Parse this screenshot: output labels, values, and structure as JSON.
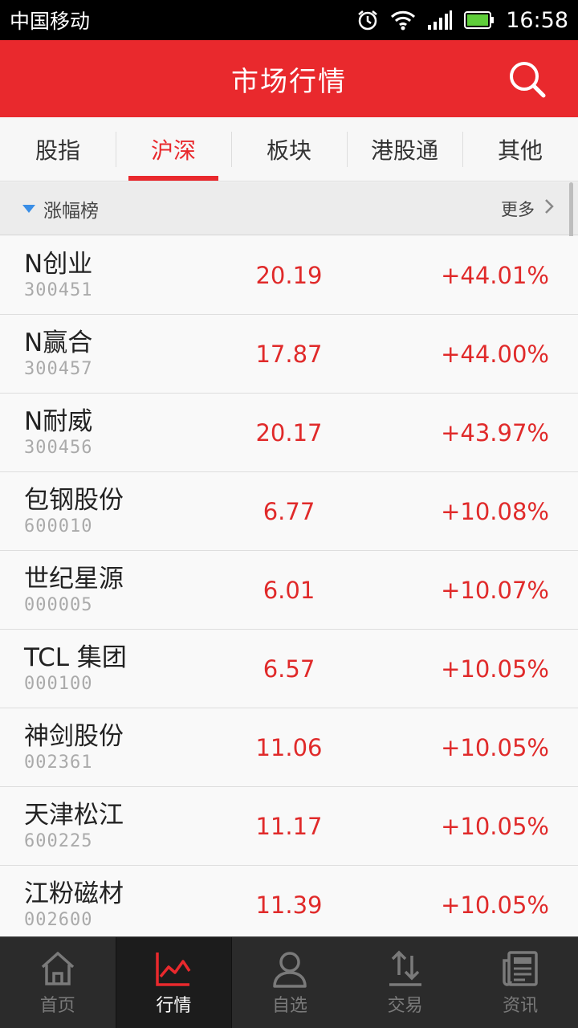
{
  "status_bar": {
    "carrier": "中国移动",
    "time": "16:58"
  },
  "header": {
    "title": "市场行情"
  },
  "tabs": [
    {
      "label": "股指"
    },
    {
      "label": "沪深"
    },
    {
      "label": "板块"
    },
    {
      "label": "港股通"
    },
    {
      "label": "其他"
    }
  ],
  "active_tab": "沪深",
  "section": {
    "title": "涨幅榜",
    "more_label": "更多"
  },
  "stocks": [
    {
      "name": "N创业",
      "code": "300451",
      "price": "20.19",
      "change": "+44.01%"
    },
    {
      "name": "N赢合",
      "code": "300457",
      "price": "17.87",
      "change": "+44.00%"
    },
    {
      "name": "N耐威",
      "code": "300456",
      "price": "20.17",
      "change": "+43.97%"
    },
    {
      "name": "包钢股份",
      "code": "600010",
      "price": "6.77",
      "change": "+10.08%"
    },
    {
      "name": "世纪星源",
      "code": "000005",
      "price": "6.01",
      "change": "+10.07%"
    },
    {
      "name": "TCL 集团",
      "code": "000100",
      "price": "6.57",
      "change": "+10.05%"
    },
    {
      "name": "神剑股份",
      "code": "002361",
      "price": "11.06",
      "change": "+10.05%"
    },
    {
      "name": "天津松江",
      "code": "600225",
      "price": "11.17",
      "change": "+10.05%"
    },
    {
      "name": "江粉磁材",
      "code": "002600",
      "price": "11.39",
      "change": "+10.05%"
    }
  ],
  "bottom_nav": [
    {
      "label": "首页",
      "icon": "home-icon"
    },
    {
      "label": "行情",
      "icon": "chart-icon"
    },
    {
      "label": "自选",
      "icon": "person-icon"
    },
    {
      "label": "交易",
      "icon": "trade-arrows-icon"
    },
    {
      "label": "资讯",
      "icon": "news-icon"
    }
  ],
  "active_nav": "行情",
  "colors": {
    "brand_red": "#e9292d",
    "price_up": "#e02a2a",
    "accent_blue": "#3a8ee6"
  }
}
